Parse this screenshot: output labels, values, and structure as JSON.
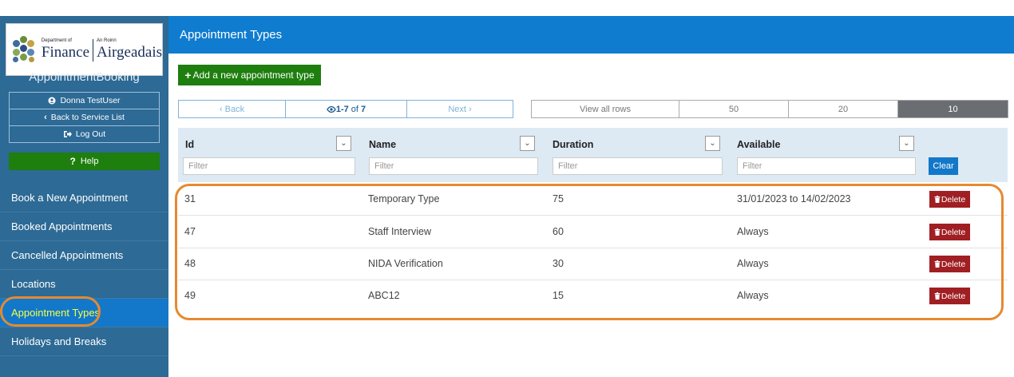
{
  "logo": {
    "left_small": "Department of",
    "left_big": "Finance",
    "right_small": "An Roinn",
    "right_big": "Airgeadais"
  },
  "app_name": "AppointmentBooking",
  "user": {
    "name": "Donna TestUser",
    "back_label": "Back to Service List",
    "logout_label": "Log Out",
    "help_label": "Help"
  },
  "nav": [
    {
      "label": "Book a New Appointment"
    },
    {
      "label": "Booked Appointments"
    },
    {
      "label": "Cancelled Appointments"
    },
    {
      "label": "Locations"
    },
    {
      "label": "Appointment Types",
      "active": true
    },
    {
      "label": "Holidays and Breaks"
    }
  ],
  "page_title": "Appointment Types",
  "add_button": "Add a new appointment type",
  "pager": {
    "back": "Back",
    "count_range": "1-7",
    "count_of": " of ",
    "count_total": "7",
    "next": "Next"
  },
  "row_options": [
    "View all rows",
    "50",
    "20",
    "10"
  ],
  "columns": [
    {
      "label": "Id",
      "filter_placeholder": "Filter"
    },
    {
      "label": "Name",
      "filter_placeholder": "Filter"
    },
    {
      "label": "Duration",
      "filter_placeholder": "Filter"
    },
    {
      "label": "Available",
      "filter_placeholder": "Filter"
    }
  ],
  "clear_label": "Clear",
  "delete_label": "Delete",
  "rows": [
    {
      "id": "31",
      "name": "Temporary Type",
      "duration": "75",
      "available": "31/01/2023 to 14/02/2023"
    },
    {
      "id": "47",
      "name": "Staff Interview",
      "duration": "60",
      "available": "Always"
    },
    {
      "id": "48",
      "name": "NIDA Verification",
      "duration": "30",
      "available": "Always"
    },
    {
      "id": "49",
      "name": "ABC12",
      "duration": "15",
      "available": "Always"
    }
  ],
  "colors": {
    "sidebar": "#2d6a95",
    "header": "#0f7ccf",
    "green": "#1e7e0e",
    "delete": "#a01f23",
    "highlight": "#e58a2f",
    "active_nav_text": "#f6ff4a"
  }
}
